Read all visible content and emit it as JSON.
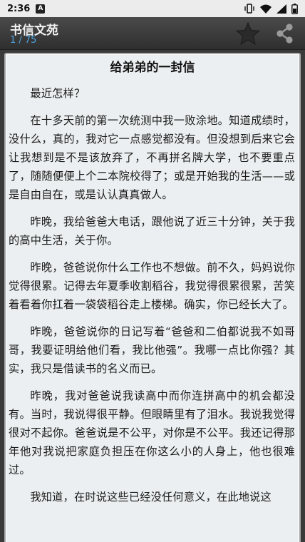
{
  "status_bar": {
    "time": "2:36",
    "notification_letter": "A"
  },
  "app_bar": {
    "title": "书信文苑",
    "page_indicator": "1 / 75"
  },
  "letter": {
    "title": "给弟弟的一封信",
    "paragraphs": [
      "最近怎样？",
      "在十多天前的第一次统测中我一败涂地。知道成绩时，没什么，真的，我对它一点感觉都没有。但没想到后来它会让我想到是不是该放弃了，不再拼名牌大学，也不要重点了，随随便便上个二本院校得了；或是开始我的生活——或是自由自在，或是认认真真做人。",
      "昨晚，我给爸爸大电话，跟他说了近三十分钟，关于我的高中生活，关于你。",
      "昨晚，爸爸说你什么工作也不想做。前不久，妈妈说你觉得很累。记得去年夏季收割稻谷，我觉得很累很累，苦笑着看着你扛着一袋袋稻谷走上楼梯。确实，你已经长大了。",
      "昨晚，爸爸说你的日记写着“爸爸和二伯都说我不如哥哥，我要证明给他们看，我比他强”。我哪一点比你强？其实，我只是借读书的名义而已。",
      "昨晚，我对爸爸说我读高中而你连拼高中的机会都没有。当时，我说得很平静。但眼睛里有了泪水。我说我觉得很对不起你。爸爸说是不公平，对你是不公平。我还记得那年他对我说把家庭负担压在你这么小的人身上，他也很难过。",
      "我知道，在时说这些已经没任何意义，在此地说这"
    ]
  }
}
